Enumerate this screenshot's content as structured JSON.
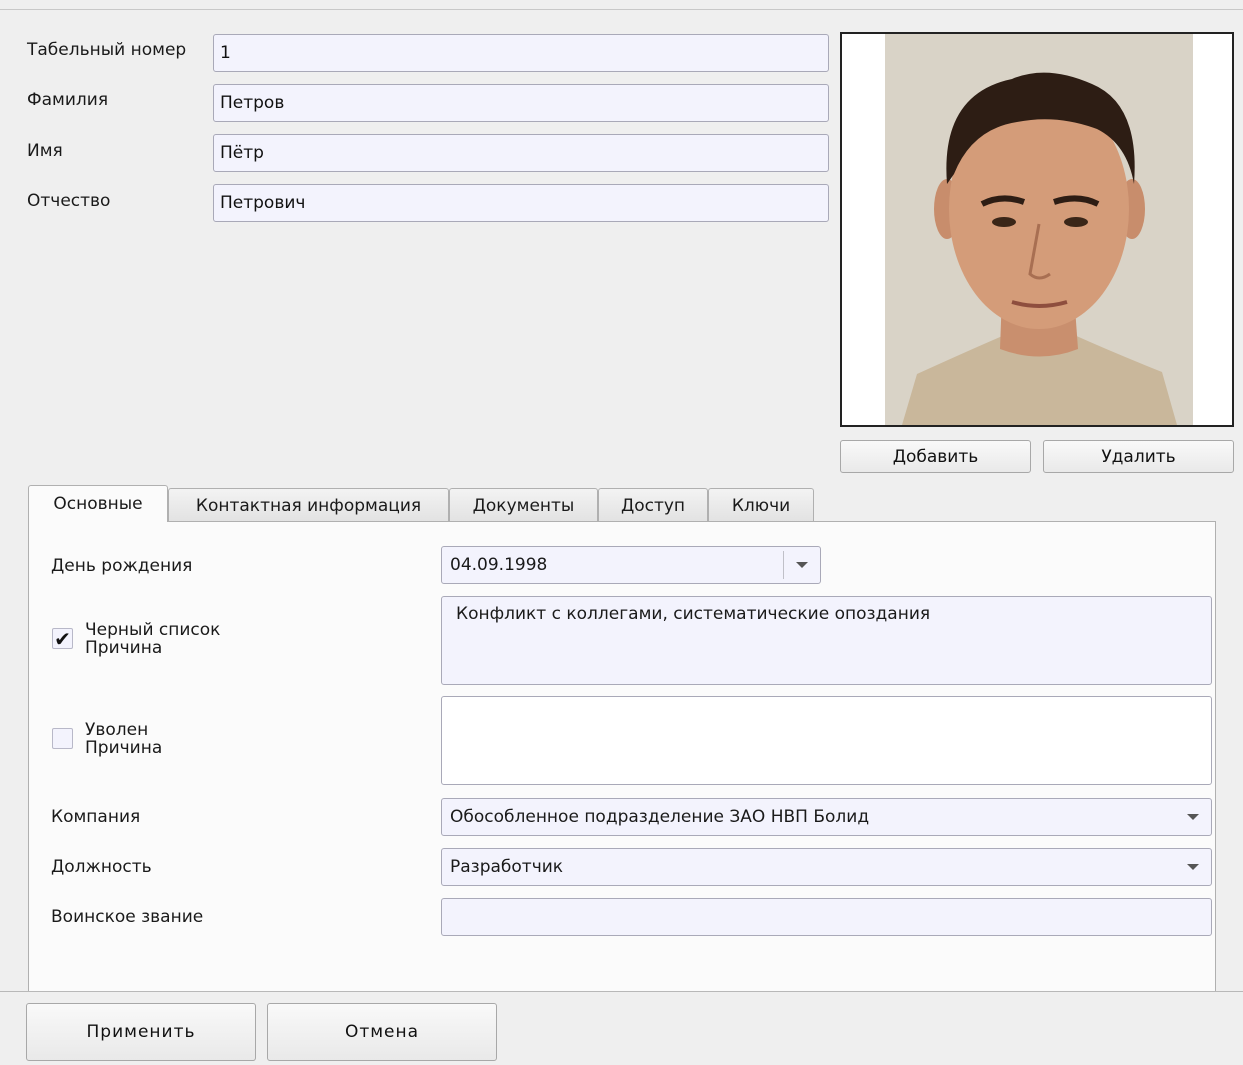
{
  "header": {
    "tab_number_label": "Табельный номер",
    "tab_number_value": "1",
    "last_name_label": "Фамилия",
    "last_name_value": "Петров",
    "first_name_label": "Имя",
    "first_name_value": "Пётр",
    "patronymic_label": "Отчество",
    "patronymic_value": "Петрович"
  },
  "photo": {
    "add_label": "Добавить",
    "delete_label": "Удалить"
  },
  "tabs": [
    {
      "label": "Основные",
      "active": true
    },
    {
      "label": "Контактная информация",
      "active": false
    },
    {
      "label": "Документы",
      "active": false
    },
    {
      "label": "Доступ",
      "active": false
    },
    {
      "label": "Ключи",
      "active": false
    }
  ],
  "main": {
    "birthday_label": "День рождения",
    "birthday_value": "04.09.1998",
    "blacklist_label": "Черный список",
    "blacklist_reason_label": "Причина",
    "blacklist_checked": true,
    "blacklist_check_glyph": "✔",
    "blacklist_reason": "Конфликт с коллегами, систематические опоздания",
    "fired_label": "Уволен",
    "fired_reason_label": "Причина",
    "fired_checked": false,
    "fired_reason": "",
    "company_label": "Компания",
    "company_value": "Обособленное подразделение ЗАО НВП Болид",
    "position_label": "Должность",
    "position_value": "Разработчик",
    "rank_label": "Воинское звание",
    "rank_value": ""
  },
  "footer": {
    "apply_label": "Применить",
    "cancel_label": "Отмена"
  },
  "colors": {
    "field_bg": "#f3f3fd",
    "window_bg": "#efefef"
  }
}
